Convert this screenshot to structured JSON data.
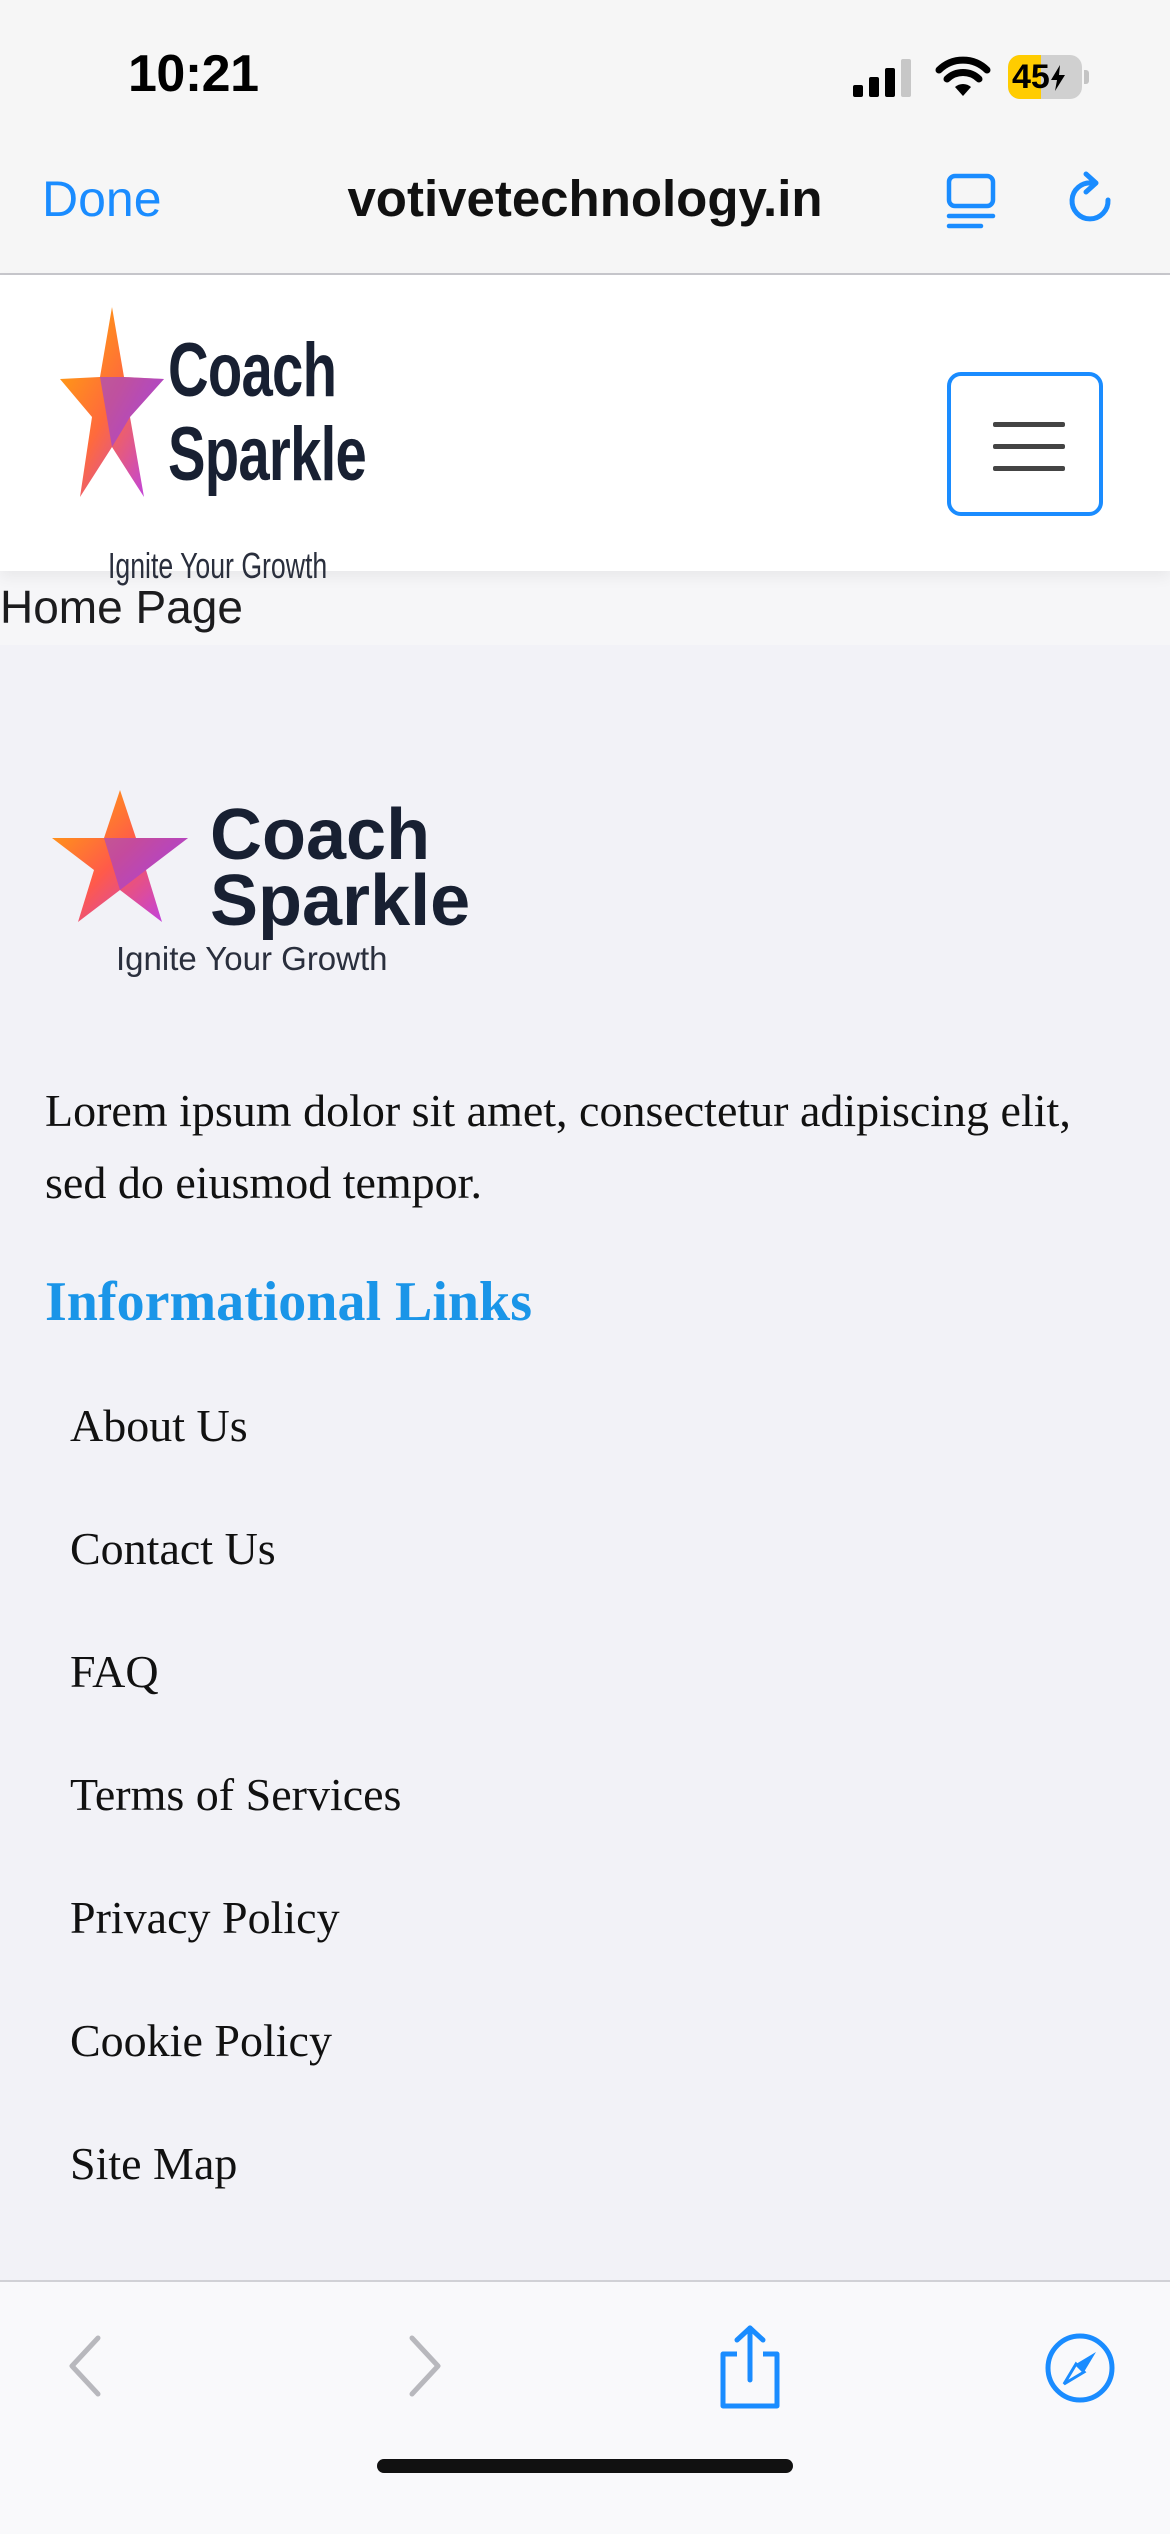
{
  "status_bar": {
    "time": "10:21",
    "battery_level": "45",
    "battery_fraction": 0.45,
    "battery_color": "#ffcc00"
  },
  "browser": {
    "done_label": "Done",
    "url": "votivetechnology.in",
    "accent_color": "#1a8cff"
  },
  "header": {
    "logo_word_1": "Coach",
    "logo_word_2": "Sparkle",
    "logo_tagline": "Ignite Your Growth",
    "menu_icon": "hamburger-icon"
  },
  "page": {
    "label": "Home Page"
  },
  "footer": {
    "logo_word_1": "Coach",
    "logo_word_2": "Sparkle",
    "logo_tagline": "Ignite Your Growth",
    "description": "Lorem ipsum dolor sit amet, consectetur adipiscing elit, sed do eiusmod tempor.",
    "links_heading": "Informational Links",
    "heading_color": "#1a95e8",
    "links": [
      "About Us",
      "Contact Us",
      "FAQ",
      "Terms of Services",
      "Privacy Policy",
      "Cookie Policy",
      "Site Map"
    ]
  },
  "toolbar": {
    "icons": [
      "back-icon",
      "forward-icon",
      "share-icon",
      "compass-icon"
    ]
  }
}
